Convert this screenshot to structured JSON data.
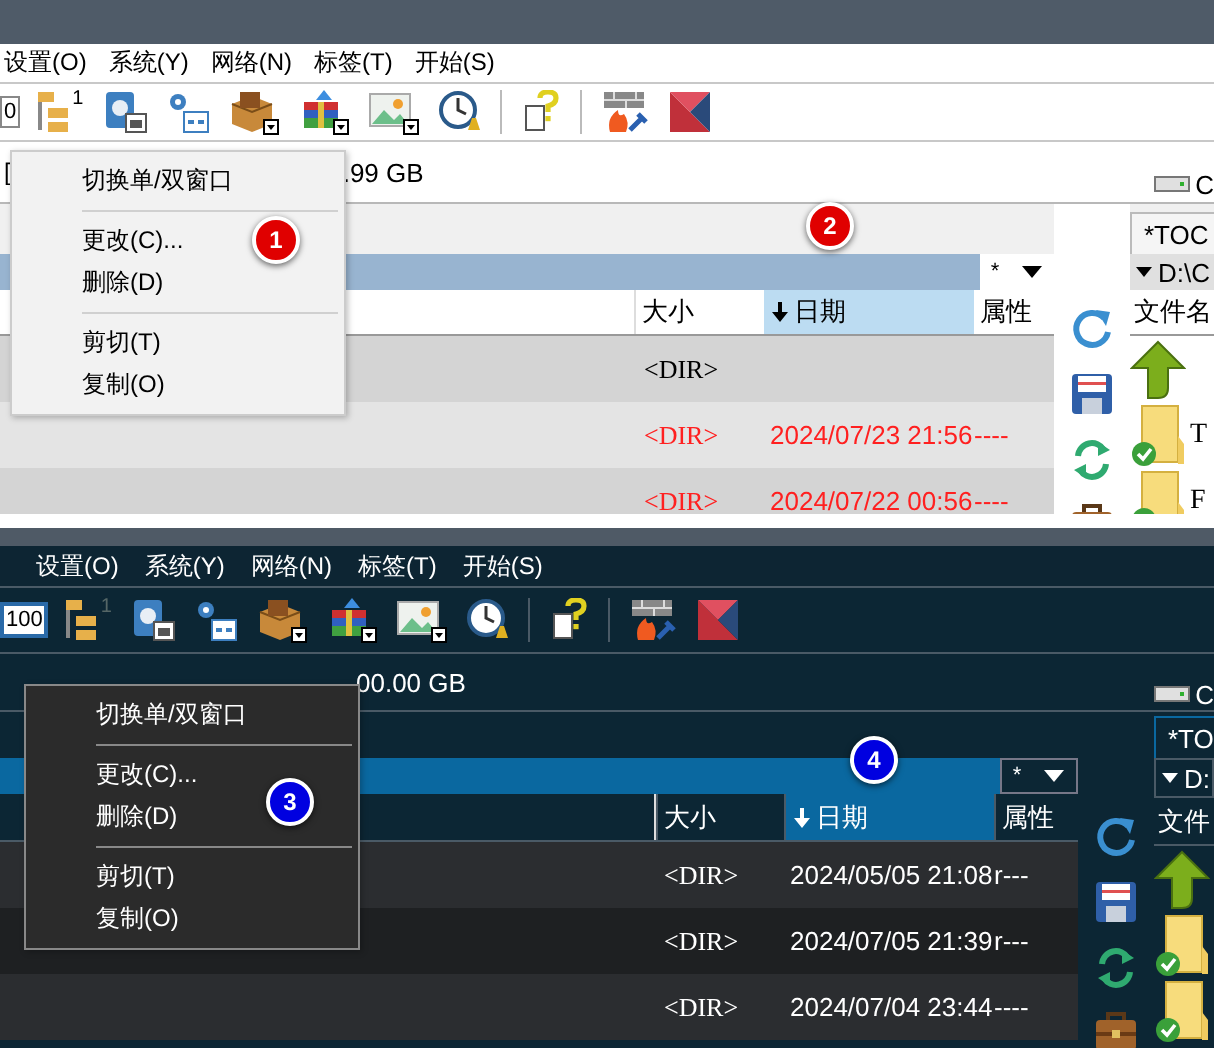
{
  "panels": [
    {
      "kind": "light",
      "menu": [
        "设置(O)",
        "系统(Y)",
        "网络(N)",
        "标签(T)",
        "开始(S)"
      ],
      "zoom_box": "0",
      "tree_badge": "1",
      "drive_left": "[",
      "drive_free": ".99 GB",
      "drive_letter": "C",
      "filter": "*",
      "columns": [
        {
          "label": "大小",
          "sorted": false
        },
        {
          "label": "日期",
          "sorted": true
        },
        {
          "label": "属性",
          "sorted": false
        }
      ],
      "rows": [
        {
          "size": "<DIR>",
          "color": "#000000"
        },
        {
          "size": "<DIR>",
          "date": "2024/07/23 21:56",
          "attr": "----",
          "color": "#ff2020"
        },
        {
          "size": "<DIR>",
          "date": "2024/07/22 00:56",
          "attr": "----",
          "color": "#ff2020"
        }
      ],
      "right": {
        "tab": "*TOC",
        "path": "D:\\C",
        "header": "文件名",
        "rows": [
          {
            "kind": "up"
          },
          {
            "kind": "folder",
            "name": "T"
          },
          {
            "kind": "folder",
            "name": "F"
          }
        ]
      },
      "context_menu": [
        {
          "kind": "item",
          "label": "切换单/双窗口"
        },
        {
          "kind": "separator"
        },
        {
          "kind": "item",
          "label": "更改(C)..."
        },
        {
          "kind": "item",
          "label": "删除(D)"
        },
        {
          "kind": "separator"
        },
        {
          "kind": "item",
          "label": "剪切(T)"
        },
        {
          "kind": "item",
          "label": "复制(O)"
        }
      ],
      "badges": [
        {
          "label": "1",
          "color": "#e00000"
        },
        {
          "label": "2",
          "color": "#e00000"
        }
      ]
    },
    {
      "kind": "dark",
      "menu": [
        "设置(O)",
        "系统(Y)",
        "网络(N)",
        "标签(T)",
        "开始(S)"
      ],
      "zoom_box": "100",
      "tree_badge": "1",
      "drive_free": "00.00 GB",
      "drive_letter": "C",
      "filter": "*",
      "columns": [
        {
          "label": "大小",
          "sorted": false
        },
        {
          "label": "日期",
          "sorted": true
        },
        {
          "label": "属性",
          "sorted": false
        }
      ],
      "rows": [
        {
          "size": "<DIR>",
          "date": "2024/05/05 21:08",
          "attr": "r---",
          "color": "#ffffff"
        },
        {
          "size": "<DIR>",
          "date": "2024/07/05 21:39",
          "attr": "r---",
          "color": "#ffffff"
        },
        {
          "size": "<DIR>",
          "date": "2024/07/04 23:44",
          "attr": "----",
          "color": "#ffffff"
        }
      ],
      "right": {
        "tab": "*TO",
        "path": "D:",
        "header": "文件",
        "rows": [
          {
            "kind": "up"
          },
          {
            "kind": "folder"
          },
          {
            "kind": "folder"
          }
        ]
      },
      "context_menu": [
        {
          "kind": "item",
          "label": "切换单/双窗口"
        },
        {
          "kind": "separator"
        },
        {
          "kind": "item",
          "label": "更改(C)..."
        },
        {
          "kind": "item",
          "label": "删除(D)"
        },
        {
          "kind": "separator"
        },
        {
          "kind": "item",
          "label": "剪切(T)"
        },
        {
          "kind": "item",
          "label": "复制(O)"
        }
      ],
      "badges": [
        {
          "label": "3",
          "color": "#0000e0"
        },
        {
          "label": "4",
          "color": "#0000e0"
        }
      ]
    }
  ]
}
